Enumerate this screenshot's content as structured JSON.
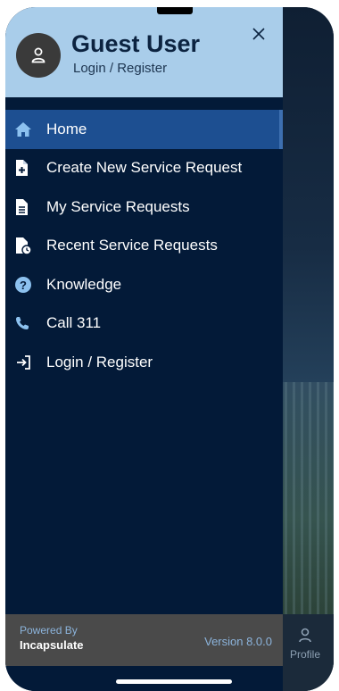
{
  "header": {
    "user_name": "Guest User",
    "user_subtitle": "Login / Register"
  },
  "menu": {
    "items": [
      {
        "label": "Home",
        "icon": "home-icon",
        "active": true
      },
      {
        "label": "Create New Service Request",
        "icon": "file-plus-icon"
      },
      {
        "label": "My Service Requests",
        "icon": "file-text-icon"
      },
      {
        "label": "Recent Service Requests",
        "icon": "file-clock-icon"
      },
      {
        "label": "Knowledge",
        "icon": "question-circle-icon"
      },
      {
        "label": "Call 311",
        "icon": "phone-icon"
      },
      {
        "label": "Login / Register",
        "icon": "login-icon"
      }
    ]
  },
  "footer": {
    "powered_by": "Powered By",
    "company": "Incapsulate",
    "version": "Version 8.0.0"
  },
  "tabbar": {
    "profile_label": "Profile"
  },
  "colors": {
    "drawer_bg": "#031a38",
    "header_bg": "#a9cdea",
    "active_bg": "#1d4f91",
    "footer_bg": "#4a4a4a"
  }
}
